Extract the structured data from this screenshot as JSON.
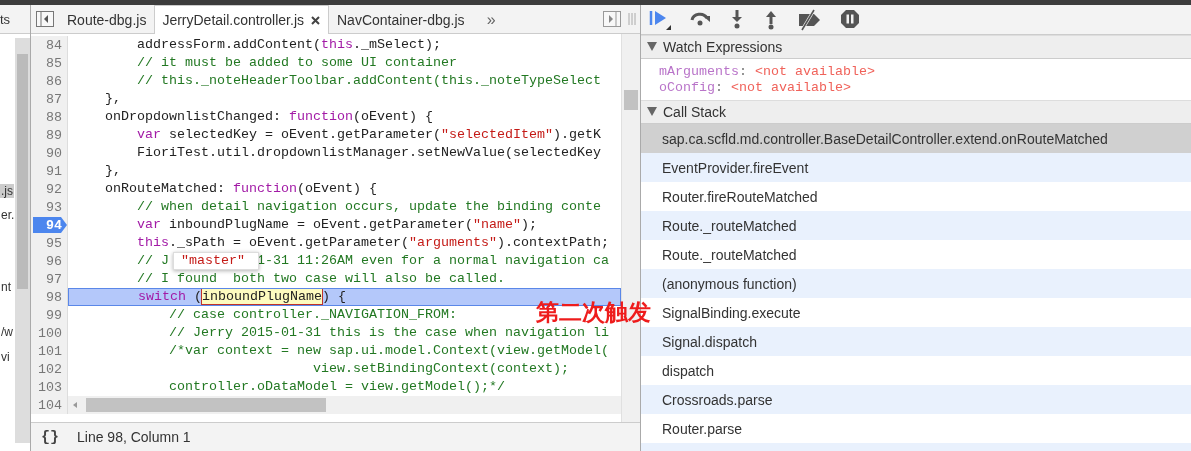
{
  "navigator": {
    "tab": "ts",
    "items": [
      {
        "text": ".js",
        "selected": true
      },
      {
        "text": "er.",
        "selected": false
      },
      {
        "text": "nt",
        "selected": false
      },
      {
        "text": "/w",
        "selected": false
      },
      {
        "text": "vi",
        "selected": false
      }
    ]
  },
  "editor_tabs": [
    {
      "label": "Route-dbg.js",
      "selected": false
    },
    {
      "label": "JerryDetail.controller.js",
      "selected": true
    },
    {
      "label": "NavContainer-dbg.js",
      "selected": false
    }
  ],
  "more_tabs": "»",
  "code": {
    "lines": [
      {
        "number": "84",
        "breakpoint": false,
        "current": false,
        "tokens": [
          {
            "kind": "plain",
            "text": "        addressForm.addContent("
          },
          {
            "kind": "keyword",
            "text": "this"
          },
          {
            "kind": "plain",
            "text": "._mSelect);"
          }
        ]
      },
      {
        "number": "85",
        "breakpoint": false,
        "current": false,
        "tokens": [
          {
            "kind": "comment",
            "text": "        // it must be added to some UI container"
          }
        ]
      },
      {
        "number": "86",
        "breakpoint": false,
        "current": false,
        "tokens": [
          {
            "kind": "comment",
            "text": "        // this._noteHeaderToolbar.addContent(this._noteTypeSelect"
          }
        ]
      },
      {
        "number": "87",
        "breakpoint": false,
        "current": false,
        "tokens": [
          {
            "kind": "plain",
            "text": "    },"
          }
        ]
      },
      {
        "number": "88",
        "breakpoint": false,
        "current": false,
        "tokens": [
          {
            "kind": "plain",
            "text": "    onDropdownlistChanged: "
          },
          {
            "kind": "keyword",
            "text": "function"
          },
          {
            "kind": "plain",
            "text": "(oEvent) {"
          }
        ]
      },
      {
        "number": "89",
        "breakpoint": false,
        "current": false,
        "tokens": [
          {
            "kind": "keyword",
            "text": "        var"
          },
          {
            "kind": "plain",
            "text": " selectedKey = oEvent.getParameter("
          },
          {
            "kind": "string",
            "text": "\"selectedItem\""
          },
          {
            "kind": "plain",
            "text": ").getK"
          }
        ]
      },
      {
        "number": "90",
        "breakpoint": false,
        "current": false,
        "tokens": [
          {
            "kind": "plain",
            "text": "        FioriTest.util.dropdownlistManager.setNewValue(selectedKey"
          }
        ]
      },
      {
        "number": "91",
        "breakpoint": false,
        "current": false,
        "tokens": [
          {
            "kind": "plain",
            "text": "    },"
          }
        ]
      },
      {
        "number": "92",
        "breakpoint": false,
        "current": false,
        "tokens": [
          {
            "kind": "plain",
            "text": "    onRouteMatched: "
          },
          {
            "kind": "keyword",
            "text": "function"
          },
          {
            "kind": "plain",
            "text": "(oEvent) {"
          }
        ]
      },
      {
        "number": "93",
        "breakpoint": false,
        "current": false,
        "tokens": [
          {
            "kind": "comment",
            "text": "        // when detail navigation occurs, update the binding conte"
          }
        ]
      },
      {
        "number": "94",
        "breakpoint": true,
        "current": false,
        "tokens": [
          {
            "kind": "keyword",
            "text": "        var"
          },
          {
            "kind": "plain",
            "text": " inboundPlugName = oEvent.getParameter("
          },
          {
            "kind": "string",
            "text": "\"name\""
          },
          {
            "kind": "plain",
            "text": ");"
          }
        ]
      },
      {
        "number": "95",
        "breakpoint": false,
        "current": false,
        "tokens": [
          {
            "kind": "keyword",
            "text": "        this"
          },
          {
            "kind": "plain",
            "text": "._sPath = oEvent.getParameter("
          },
          {
            "kind": "string",
            "text": "\"arguments\""
          },
          {
            "kind": "plain",
            "text": ").contextPath;"
          }
        ]
      },
      {
        "number": "96",
        "breakpoint": false,
        "current": false,
        "covered": true,
        "tokens": [
          {
            "kind": "comment",
            "text": "        // J"
          },
          {
            "kind": "comment",
            "text": "1-31 11:26AM even for a normal navigation ca"
          }
        ]
      },
      {
        "number": "97",
        "breakpoint": false,
        "current": false,
        "tokens": [
          {
            "kind": "comment",
            "text": "        // I found  both two case will also be called."
          }
        ]
      },
      {
        "number": "98",
        "breakpoint": false,
        "current": true,
        "tokens": [
          {
            "kind": "keyword",
            "text": "        switch"
          },
          {
            "kind": "plain",
            "text": " ("
          },
          {
            "kind": "highlight",
            "text": "inboundPlugName"
          },
          {
            "kind": "plain",
            "text": ") {"
          }
        ]
      },
      {
        "number": "99",
        "breakpoint": false,
        "current": false,
        "tokens": [
          {
            "kind": "comment",
            "text": "            // case controller._NAVIGATION_FROM:"
          }
        ]
      },
      {
        "number": "100",
        "breakpoint": false,
        "current": false,
        "tokens": [
          {
            "kind": "comment",
            "text": "            // Jerry 2015-01-31 this is the case when navigation li"
          }
        ]
      },
      {
        "number": "101",
        "breakpoint": false,
        "current": false,
        "tokens": [
          {
            "kind": "comment",
            "text": "            /*var context = new sap.ui.model.Context(view.getModel("
          }
        ]
      },
      {
        "number": "102",
        "breakpoint": false,
        "current": false,
        "tokens": [
          {
            "kind": "comment",
            "text": "                              view.setBindingContext(context);"
          }
        ]
      },
      {
        "number": "103",
        "breakpoint": false,
        "current": false,
        "tokens": [
          {
            "kind": "comment",
            "text": "            controller.oDataModel = view.getModel();*/"
          }
        ]
      },
      {
        "number": "104",
        "breakpoint": false,
        "current": false
      }
    ],
    "tooltip": "\"master\"",
    "status": {
      "format_button": "{}",
      "position": "Line 98, Column 1"
    }
  },
  "debugger": {
    "watch": {
      "title": "Watch Expressions",
      "expanded": true,
      "items": [
        {
          "name": "mArguments",
          "separator": ":",
          "value": "<not available>"
        },
        {
          "name": "oConfig",
          "separator": ":",
          "value": "<not available>"
        }
      ]
    },
    "call_stack": {
      "title": "Call Stack",
      "expanded": true,
      "frames": [
        {
          "name": "sap.ca.scfld.md.controller.BaseDetailController.extend.onRouteMatched",
          "selected": true
        },
        {
          "name": "EventProvider.fireEvent",
          "selected": false
        },
        {
          "name": "Router.fireRouteMatched",
          "selected": false
        },
        {
          "name": "Route._routeMatched",
          "selected": false
        },
        {
          "name": "Route._routeMatched",
          "selected": false
        },
        {
          "name": "(anonymous function)",
          "selected": false
        },
        {
          "name": "SignalBinding.execute",
          "selected": false
        },
        {
          "name": "Signal.dispatch",
          "selected": false
        },
        {
          "name": "dispatch",
          "selected": false
        },
        {
          "name": "Crossroads.parse",
          "selected": false
        },
        {
          "name": "Router.parse",
          "selected": false
        }
      ]
    }
  },
  "annotation": "第二次触发"
}
